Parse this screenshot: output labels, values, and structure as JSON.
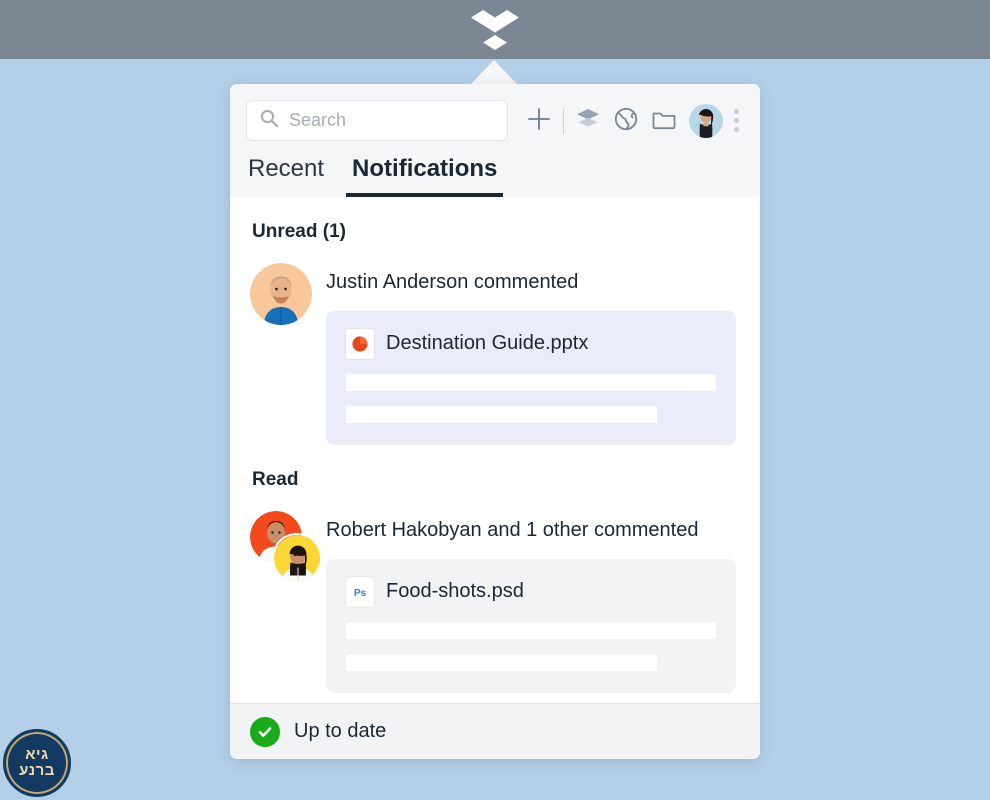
{
  "menubar": {
    "logo_icon": "dropbox-logo-icon",
    "background": "#7c8794"
  },
  "panel": {
    "search": {
      "icon": "search-icon",
      "value": "",
      "placeholder": "Search"
    },
    "toolbar_buttons": [
      {
        "name": "create-new-button",
        "icon": "plus-icon",
        "label": "Create new"
      },
      {
        "name": "paper-docs-button",
        "icon": "layers-icon",
        "label": "Paper"
      },
      {
        "name": "dropbox-web-button",
        "icon": "globe-icon",
        "label": "Open Dropbox.com"
      },
      {
        "name": "open-folder-button",
        "icon": "folder-icon",
        "label": "Open folder"
      }
    ],
    "account_avatar": {
      "name": "account-avatar",
      "icon": "avatar-icon"
    },
    "overflow_menu": {
      "name": "overflow-menu-button",
      "icon": "kebab-menu-icon"
    },
    "tabs": [
      {
        "label": "Recent",
        "active": false
      },
      {
        "label": "Notifications",
        "active": true
      }
    ],
    "sections": [
      {
        "title": "Unread (1)",
        "notifications": [
          {
            "avatar_style": "single",
            "avatar_bg": "#f7c89b",
            "text": "Justin Anderson commented",
            "card_style": "unread",
            "card_bg": "#eaecfa",
            "file": {
              "icon": "powerpoint-file-icon",
              "icon_color": "#ec5b26",
              "name": "Destination Guide.pptx"
            },
            "placeholder_bars": [
              "full",
              "part"
            ]
          }
        ]
      },
      {
        "title": "Read",
        "notifications": [
          {
            "avatar_style": "stacked",
            "avatar_bg": "#f4491a",
            "avatar_bg2": "#fbd634",
            "text": "Robert Hakobyan and 1 other commented",
            "card_style": "read",
            "card_bg": "#f1f3f5",
            "file": {
              "icon": "photoshop-file-icon",
              "icon_color": "#2e7ff0",
              "icon_text": "Ps",
              "name": "Food-shots.psd"
            },
            "placeholder_bars": [
              "full",
              "part"
            ]
          }
        ]
      }
    ],
    "footer": {
      "icon": "check-circle-icon",
      "icon_color": "#1aab1a",
      "status": "Up to date"
    }
  },
  "watermark": {
    "line1": "גיא",
    "line2": "ברנע",
    "background": "#123a63",
    "text_color": "#f0d9a8"
  }
}
